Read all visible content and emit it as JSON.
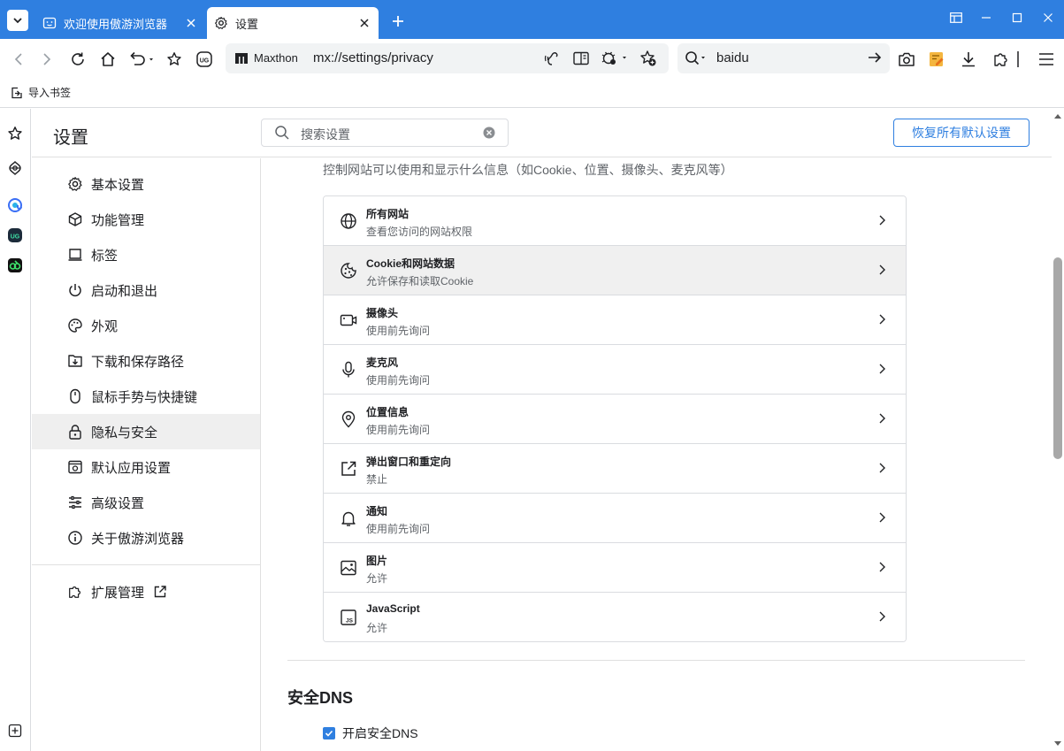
{
  "tabs": [
    {
      "label": "欢迎使用傲游浏览器",
      "active": false
    },
    {
      "label": "设置",
      "active": true
    }
  ],
  "address": {
    "brand": "Maxthon",
    "url": "mx://settings/privacy"
  },
  "search_bar": {
    "query": "baidu"
  },
  "bookmarks": {
    "import_label": "导入书签"
  },
  "settings": {
    "title": "设置",
    "search_placeholder": "搜索设置",
    "reset_button": "恢复所有默认设置"
  },
  "nav": {
    "items": [
      {
        "label": "基本设置",
        "icon": "gear-icon"
      },
      {
        "label": "功能管理",
        "icon": "cube-icon"
      },
      {
        "label": "标签",
        "icon": "tab-icon"
      },
      {
        "label": "启动和退出",
        "icon": "power-icon"
      },
      {
        "label": "外观",
        "icon": "palette-icon"
      },
      {
        "label": "下载和保存路径",
        "icon": "download-folder-icon"
      },
      {
        "label": "鼠标手势与快捷键",
        "icon": "mouse-icon"
      },
      {
        "label": "隐私与安全",
        "icon": "lock-icon",
        "active": true
      },
      {
        "label": "默认应用设置",
        "icon": "default-app-icon"
      },
      {
        "label": "高级设置",
        "icon": "sliders-icon"
      },
      {
        "label": "关于傲游浏览器",
        "icon": "info-icon"
      }
    ],
    "extensions": {
      "label": "扩展管理",
      "icon": "puzzle-icon"
    }
  },
  "privacy": {
    "description": "控制网站可以使用和显示什么信息（如Cookie、位置、摄像头、麦克风等）",
    "permissions": [
      {
        "title": "所有网站",
        "subtitle": "查看您访问的网站权限",
        "icon": "globe-icon"
      },
      {
        "title": "Cookie和网站数据",
        "subtitle": "允许保存和读取Cookie",
        "icon": "cookie-icon"
      },
      {
        "title": "摄像头",
        "subtitle": "使用前先询问",
        "icon": "camera-icon"
      },
      {
        "title": "麦克风",
        "subtitle": "使用前先询问",
        "icon": "microphone-icon"
      },
      {
        "title": "位置信息",
        "subtitle": "使用前先询问",
        "icon": "location-icon"
      },
      {
        "title": "弹出窗口和重定向",
        "subtitle": "禁止",
        "icon": "popup-icon"
      },
      {
        "title": "通知",
        "subtitle": "使用前先询问",
        "icon": "bell-icon"
      },
      {
        "title": "图片",
        "subtitle": "允许",
        "icon": "image-icon"
      },
      {
        "title": "JavaScript",
        "subtitle": "允许",
        "icon": "javascript-icon"
      }
    ]
  },
  "secure_dns": {
    "title": "安全DNS",
    "checkbox_label": "开启安全DNS",
    "checked": true
  },
  "colors": {
    "accent": "#2f7fe0",
    "titlebar": "#2f7fe0"
  }
}
